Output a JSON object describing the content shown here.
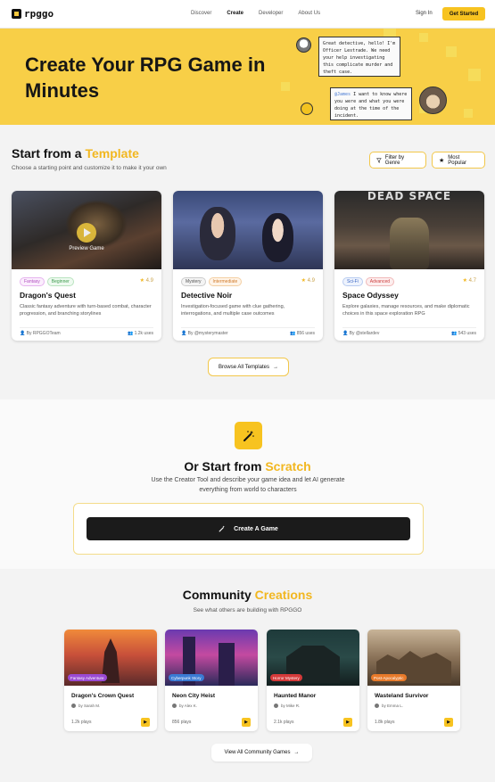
{
  "nav": {
    "logo_text": "rpggo",
    "links": [
      "Discover",
      "Create",
      "Developer",
      "About Us"
    ],
    "active": "Create",
    "sign_in": "Sign In",
    "get_started": "Get Started"
  },
  "hero": {
    "title": "Create Your RPG Game in Minutes",
    "bubble1": "Great detective, hello! I'm Officer Lestrade. We need your help investigating this complicate murder and theft case.",
    "bubble2_mention": "@James",
    "bubble2": " I want to know where you were and what you were doing at the time of the incident."
  },
  "templates": {
    "title_pre": "Start from a ",
    "title_hl": "Template",
    "subtitle": "Choose a starting point and customize it to make it your own",
    "filter_label": "Filter by Genre",
    "sort_label": "Most Popular",
    "preview_label": "Preview Game",
    "cards": [
      {
        "tags": [
          "Fantasy",
          "Beginner"
        ],
        "rating": "4.9",
        "title": "Dragon's Quest",
        "desc": "Classic fantasy adventure with turn-based combat, character progression, and branching storylines",
        "author": "By RPGGOTeam",
        "uses": "1.2k uses"
      },
      {
        "tags": [
          "Mystery",
          "Intermediate"
        ],
        "rating": "4.9",
        "title": "Detective Noir",
        "desc": "Investigation-focused game with clue gathering, interrogations, and multiple case outcomes",
        "author": "By @mysterymaster",
        "uses": "856 uses"
      },
      {
        "tags": [
          "Sci-Fi",
          "Advanced"
        ],
        "rating": "4.7",
        "title": "Space Odyssey",
        "desc": "Explore galaxies, manage resources, and make diplomatic choices in this space exploration RPG",
        "author": "By @stellardev",
        "uses": "543 uses",
        "banner": "DEAD SPACE"
      }
    ],
    "browse_label": "Browse All Templates"
  },
  "scratch": {
    "title_pre": "Or Start from ",
    "title_hl": "Scratch",
    "subtitle": "Use the Creator Tool and describe your game idea and let AI generate everything from world to characters",
    "button": "Create A Game"
  },
  "community": {
    "title_pre": "Community ",
    "title_hl": "Creations",
    "subtitle": "See what others are building with RPGGO",
    "games": [
      {
        "badge": "Fantasy Adventure",
        "title": "Dragon's Crown Quest",
        "by": "by Sarah M.",
        "plays": "1.2k plays"
      },
      {
        "badge": "Cyberpunk Story",
        "title": "Neon City Heist",
        "by": "by Alex K.",
        "plays": "856 plays"
      },
      {
        "badge": "Horror Mystery",
        "title": "Haunted Manor",
        "by": "by Mike R.",
        "plays": "2.1k plays"
      },
      {
        "badge": "Post-Apocalyptic",
        "title": "Wasteland Survivor",
        "by": "by Emma L.",
        "plays": "1.8k plays"
      }
    ],
    "view_all": "View All Community Games"
  },
  "colors": {
    "accent": "#f7c320",
    "hero_bg": "#f8cf47"
  }
}
